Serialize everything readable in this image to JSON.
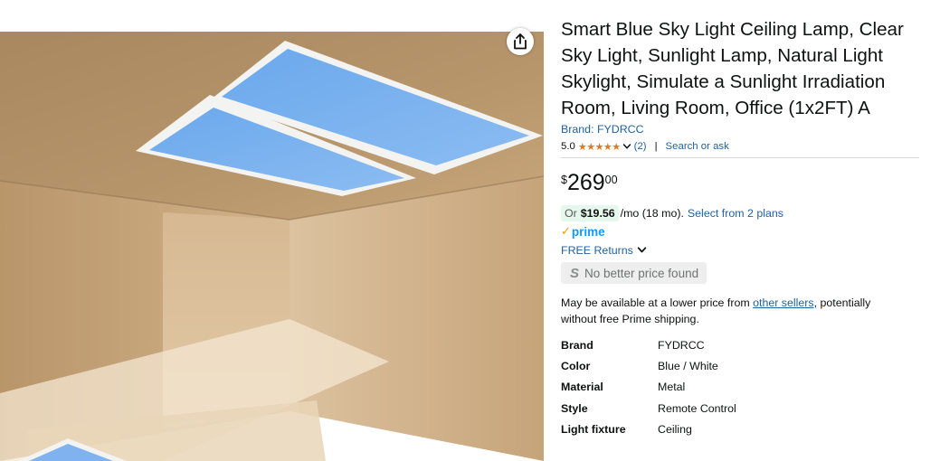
{
  "product": {
    "title": "Smart Blue Sky Light Ceiling Lamp, Clear Sky Light, Sunlight Lamp, Natural Light Skylight, Simulate a Sunlight Irradiation Room, Living Room, Office (1x2FT) A",
    "brand_link": "Brand: FYDRCC"
  },
  "rating": {
    "value": "5.0",
    "stars": "★★★★★",
    "count": "(2)",
    "separator": "|",
    "search_ask": "Search or ask"
  },
  "price": {
    "currency": "$",
    "whole": "269",
    "fraction": "00"
  },
  "installment": {
    "or": "Or",
    "amount": "$19.56",
    "rest": "/mo (18 mo).",
    "plans_link": "Select from 2 plans"
  },
  "prime": {
    "check": "✓",
    "label": "prime"
  },
  "returns": {
    "label": "FREE Returns"
  },
  "no_better_price": {
    "icon_letter": "S",
    "label": "No better price found"
  },
  "availability_note": {
    "before": "May be available at a lower price from ",
    "link": "other sellers",
    "after": ", potentially without free Prime shipping."
  },
  "specs": [
    {
      "key": "Brand",
      "value": "FYDRCC"
    },
    {
      "key": "Color",
      "value": "Blue / White"
    },
    {
      "key": "Material",
      "value": "Metal"
    },
    {
      "key": "Style",
      "value": "Remote Control"
    },
    {
      "key": "Light fixture",
      "value": "Ceiling"
    }
  ],
  "icons": {
    "share": "share-icon",
    "rating_dropdown": "chevron-down-icon",
    "returns_dropdown": "chevron-down-icon"
  },
  "colors": {
    "link": "#2162a1",
    "star": "#de7921",
    "prime": "#1399ff",
    "installment_badge": "#e6f7ed"
  }
}
